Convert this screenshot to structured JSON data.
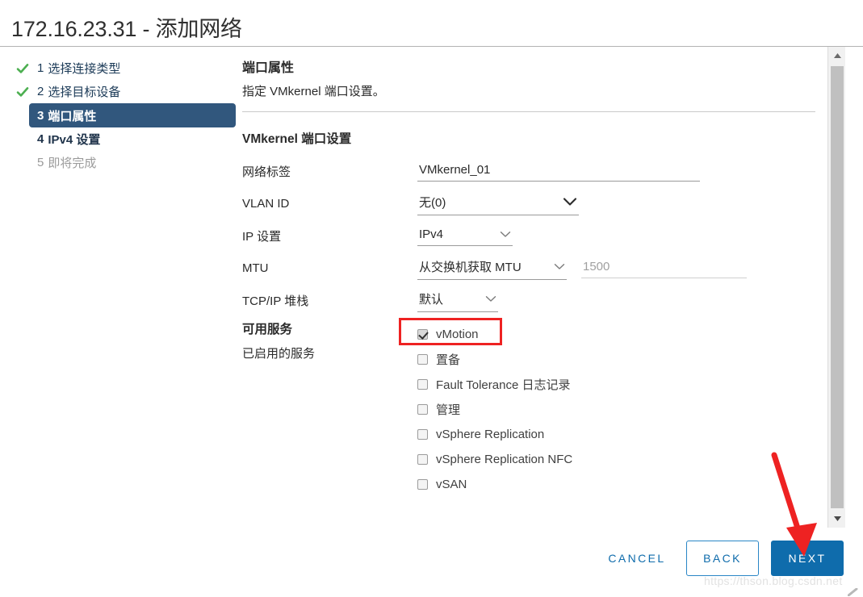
{
  "window": {
    "title": "172.16.23.31 - 添加网络"
  },
  "steps": [
    {
      "num": "1",
      "label": "选择连接类型",
      "state": "done",
      "icon": "check-icon"
    },
    {
      "num": "2",
      "label": "选择目标设备",
      "state": "done",
      "icon": "check-icon"
    },
    {
      "num": "3",
      "label": "端口属性",
      "state": "active",
      "icon": ""
    },
    {
      "num": "4",
      "label": "IPv4 设置",
      "state": "upcoming",
      "icon": ""
    },
    {
      "num": "5",
      "label": "即将完成",
      "state": "pending",
      "icon": ""
    }
  ],
  "panel": {
    "title": "端口属性",
    "description": "指定 VMkernel 端口设置。",
    "section_title": "VMkernel 端口设置",
    "fields": {
      "network_label": {
        "label": "网络标签",
        "value": "VMkernel_01",
        "placeholder": ""
      },
      "vlan_id": {
        "label": "VLAN ID",
        "value": "无(0)"
      },
      "ip_settings": {
        "label": "IP 设置",
        "value": "IPv4"
      },
      "mtu": {
        "label": "MTU",
        "value": "从交换机获取 MTU",
        "mtu_value": "1500"
      },
      "tcpip_stack": {
        "label": "TCP/IP 堆栈",
        "value": "默认"
      }
    }
  },
  "services": {
    "title": "可用服务",
    "subtitle": "已启用的服务",
    "items": [
      {
        "label": "vMotion",
        "checked": true
      },
      {
        "label": "置备",
        "checked": false
      },
      {
        "label": "Fault Tolerance 日志记录",
        "checked": false
      },
      {
        "label": "管理",
        "checked": false
      },
      {
        "label": "vSphere Replication",
        "checked": false
      },
      {
        "label": "vSphere Replication NFC",
        "checked": false
      },
      {
        "label": "vSAN",
        "checked": false
      }
    ]
  },
  "footer": {
    "cancel_label": "CANCEL",
    "back_label": "BACK",
    "next_label": "NEXT"
  },
  "annotations": {
    "highlight_target": "vMotion",
    "arrow_target": "NEXT"
  },
  "watermark": {
    "text": "https://thson.blog.csdn.net"
  },
  "colors": {
    "active_step_bg": "#31577d",
    "primary_button": "#0f6cac",
    "link_blue": "#0f6cac",
    "check_green": "#4caf50",
    "annotation_red": "#ee2222"
  }
}
